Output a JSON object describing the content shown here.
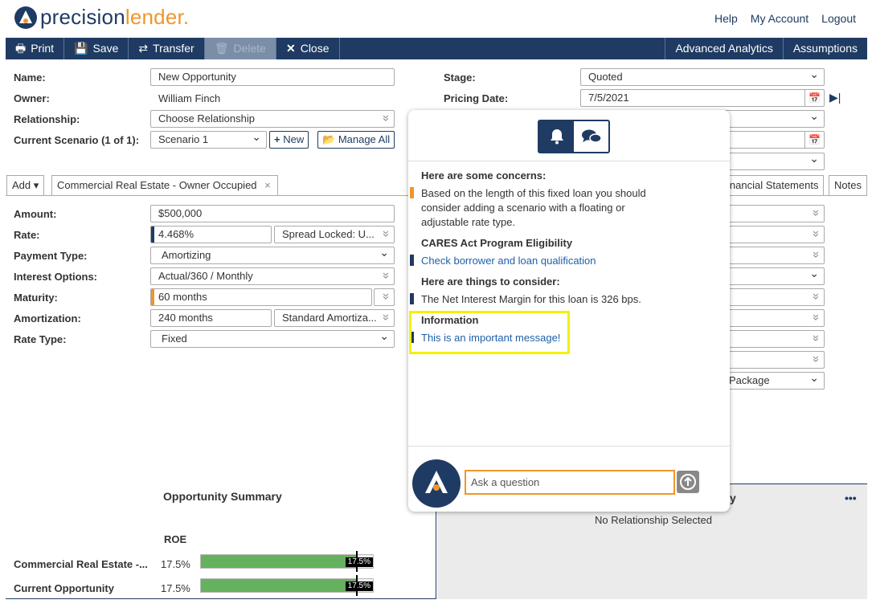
{
  "brand": {
    "part1": "precision",
    "part2": "lender",
    "suffix": "."
  },
  "top_links": {
    "help": "Help",
    "account": "My Account",
    "logout": "Logout"
  },
  "toolbar": {
    "print": "Print",
    "save": "Save",
    "transfer": "Transfer",
    "delete": "Delete",
    "close": "Close",
    "analytics": "Advanced Analytics",
    "assumptions": "Assumptions"
  },
  "form": {
    "name_label": "Name:",
    "name_value": "New Opportunity",
    "owner_label": "Owner:",
    "owner_value": "William Finch",
    "relationship_label": "Relationship:",
    "relationship_value": "Choose Relationship",
    "scenario_label": "Current Scenario (1 of 1):",
    "scenario_value": "Scenario 1",
    "new_btn": "New",
    "manage_btn": "Manage All",
    "stage_label": "Stage:",
    "stage_value": "Quoted",
    "pricing_date_label": "Pricing Date:",
    "pricing_date_value": "7/5/2021"
  },
  "tabs": {
    "add": "Add",
    "loan_tab": "Commercial Real Estate - Owner Occupied",
    "financial": "inancial Statements",
    "notes": "Notes"
  },
  "loan": {
    "amount_label": "Amount:",
    "amount_value": "$500,000",
    "rate_label": "Rate:",
    "rate_value": "4.468%",
    "spread_value": "Spread Locked: U...",
    "payment_label": "Payment Type:",
    "payment_value": "Amortizing",
    "interest_label": "Interest Options:",
    "interest_value": "Actual/360 / Monthly",
    "maturity_label": "Maturity:",
    "maturity_value": "60 months",
    "amort_label": "Amortization:",
    "amort_value": "240 months",
    "amort_type": "Standard Amortiza...",
    "ratetype_label": "Rate Type:",
    "ratetype_value": "Fixed"
  },
  "right_col": {
    "package": "Package"
  },
  "panel": {
    "concerns_title": "Here are some concerns:",
    "concern_msg": "Based on the length of this fixed loan you should consider adding a scenario with a floating or adjustable rate type.",
    "cares_title": "CARES Act Program Eligibility",
    "cares_link": "Check borrower and loan qualification",
    "consider_title": "Here are things to consider:",
    "consider_msg": "The Net Interest Margin for this loan is 326 bps.",
    "info_title": "Information",
    "info_link": "This is an important message!",
    "ask_placeholder": "Ask a question"
  },
  "summary": {
    "title": "Opportunity Summary",
    "roe_label": "ROE",
    "rows": [
      {
        "label": "Commercial Real Estate -...",
        "value": "17.5%",
        "tag": "17.5%",
        "fill": 0.9
      },
      {
        "label": "Current Opportunity",
        "value": "17.5%",
        "tag": "17.5%",
        "fill": 0.9
      }
    ]
  },
  "relationship_box": {
    "title_fragment": "y",
    "empty_text": "No Relationship Selected",
    "more": "•••"
  },
  "colors": {
    "navy": "#1f3b63",
    "orange": "#f0962b",
    "green": "#66b15e",
    "highlight": "#f5f000"
  }
}
